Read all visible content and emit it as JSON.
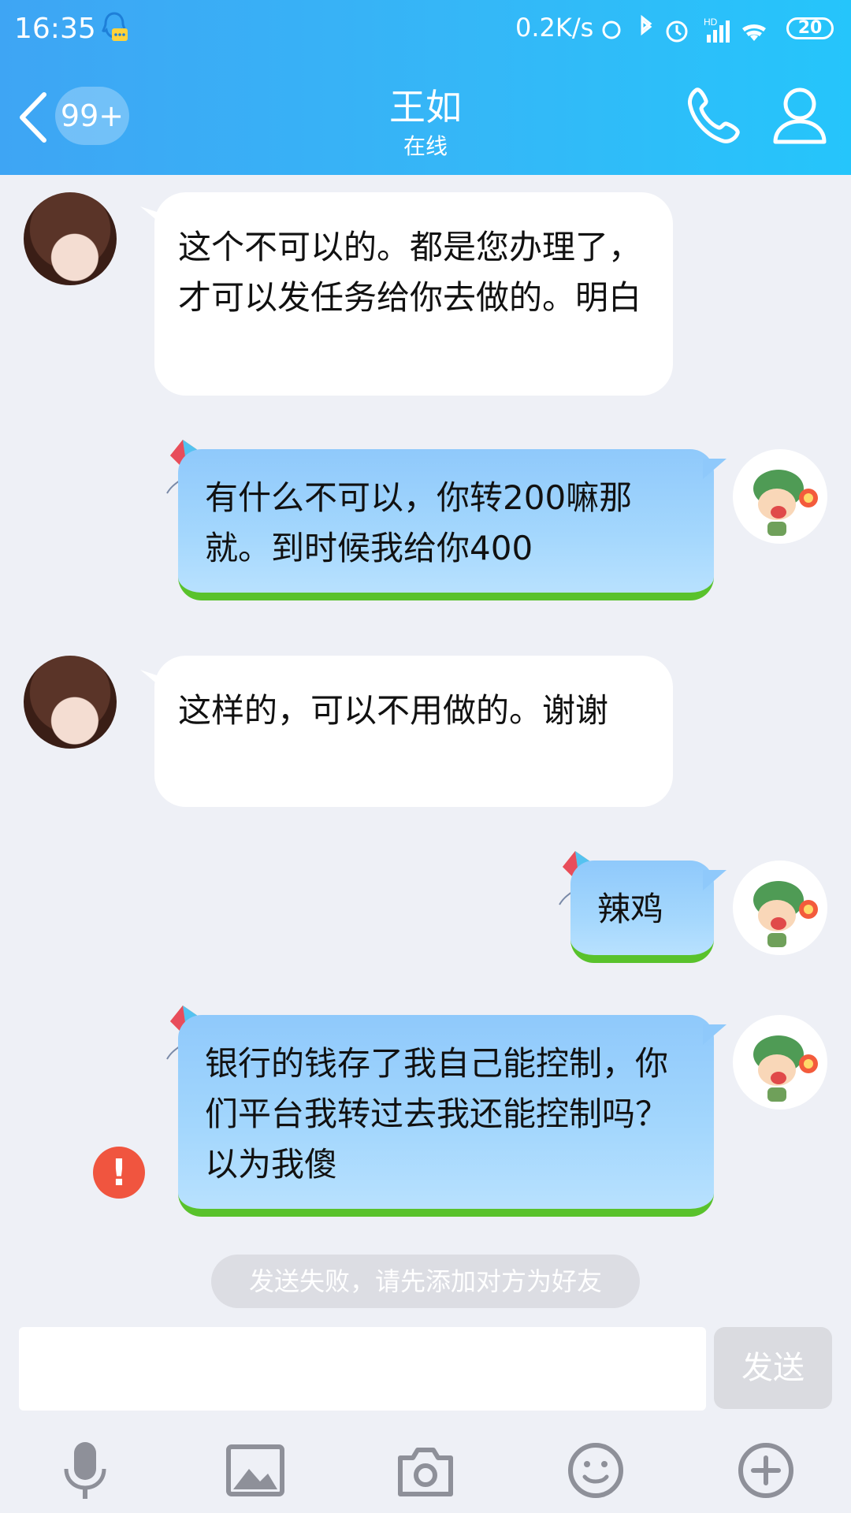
{
  "status_bar": {
    "time": "16:35",
    "network_speed": "0.2K/s",
    "battery": "20"
  },
  "header": {
    "back_count": "99+",
    "contact_name": "王如",
    "contact_status": "在线",
    "colors": {
      "gradient_start": "#3ea5f4",
      "gradient_end": "#25c5fb"
    }
  },
  "messages": [
    {
      "side": "in",
      "text": "这个不可以的。都是您办理了，才可以发任务给你去做的。明白"
    },
    {
      "side": "out",
      "text": "有什么不可以，你转200嘛那就。到时候我给你400"
    },
    {
      "side": "in",
      "text": "这样的，可以不用做的。谢谢"
    },
    {
      "side": "out",
      "text": "辣鸡"
    },
    {
      "side": "out",
      "text": "银行的钱存了我自己能控制，你们平台我转过去我还能控制吗？以为我傻",
      "status": "failed"
    }
  ],
  "error_mark": "!",
  "notice": "发送失败，请先添加对方为好友",
  "input": {
    "value": "",
    "placeholder": ""
  },
  "send_label": "发送",
  "toolbar": [
    "microphone-icon",
    "image-icon",
    "camera-icon",
    "emoji-icon",
    "plus-icon"
  ]
}
